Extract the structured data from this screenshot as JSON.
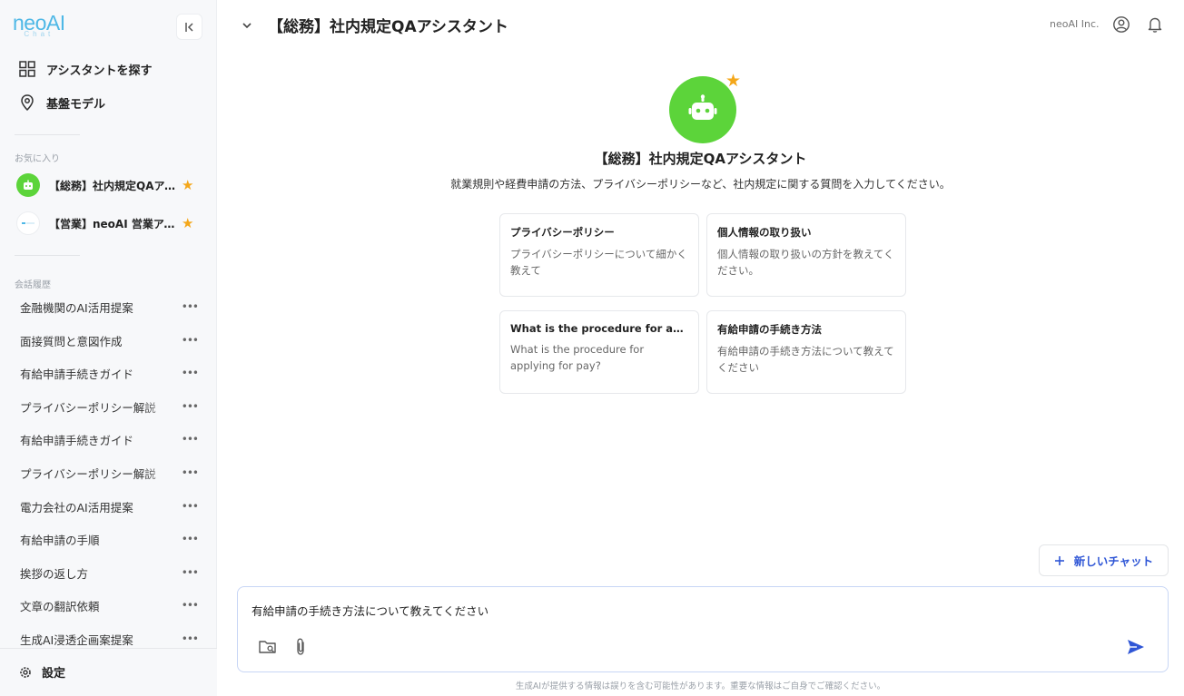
{
  "sidebar": {
    "logo": {
      "main": "neoAI",
      "sub": "Chat"
    },
    "nav": [
      {
        "label": "アシスタントを探す",
        "icon": "grid-icon"
      },
      {
        "label": "基盤モデル",
        "icon": "map-pin-icon"
      }
    ],
    "favorites_label": "お気に入り",
    "favorites": [
      {
        "label": "【総務】社内規定QAアシスタント",
        "icon": "robot-icon"
      },
      {
        "label": "【営業】neoAI 営業アシスタント",
        "icon": "company-logo-icon"
      }
    ],
    "history_label": "会話履歴",
    "history": [
      {
        "label": "金融機関のAI活用提案"
      },
      {
        "label": "面接質問と意図作成"
      },
      {
        "label": "有給申請手続きガイド"
      },
      {
        "label": "プライバシーポリシー解説"
      },
      {
        "label": "有給申請手続きガイド"
      },
      {
        "label": "プライバシーポリシー解説"
      },
      {
        "label": "電力会社のAI活用提案"
      },
      {
        "label": "有給申請の手順"
      },
      {
        "label": "挨拶の返し方"
      },
      {
        "label": "文章の翻訳依頼"
      },
      {
        "label": "生成AI浸透企画案提案"
      }
    ],
    "more": "•••",
    "settings_label": "設定"
  },
  "header": {
    "title": "【総務】社内規定QAアシスタント",
    "org": "neoAI Inc."
  },
  "assistant": {
    "title": "【総務】社内規定QAアシスタント",
    "description": "就業規則や経費申請の方法、プライバシーポリシーなど、社内規定に関する質問を入力してください。",
    "star": "★"
  },
  "suggestions": [
    {
      "title": "プライバシーポリシー",
      "body": "プライバシーポリシーについて細かく教えて"
    },
    {
      "title": "個人情報の取り扱い",
      "body": "個人情報の取り扱いの方針を教えてください。"
    },
    {
      "title": "What is the procedure for applying for pay?",
      "body": "What is the procedure for applying for pay?"
    },
    {
      "title": "有給申請の手続き方法",
      "body": "有給申請の手続き方法について教えてください"
    }
  ],
  "new_chat_label": "新しいチャット",
  "composer": {
    "value": "有給申請の手続き方法について教えてください"
  },
  "disclaimer": "生成AIが提供する情報は誤りを含む可能性があります。重要な情報はご自身でご確認ください。",
  "colors": {
    "brand": "#4fb8e6",
    "accent": "#2f56d6",
    "bot_green": "#5cd43a",
    "star": "#f4a71a"
  }
}
